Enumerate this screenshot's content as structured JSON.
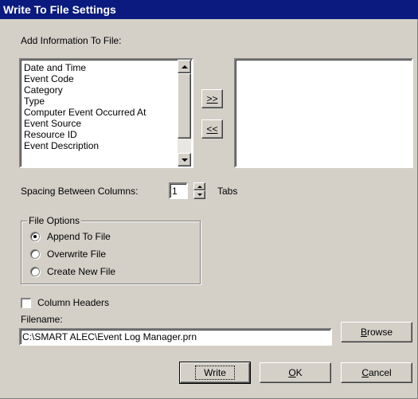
{
  "dialog": {
    "title": "Write To File Settings"
  },
  "add_info": {
    "label": "Add Information To File:",
    "available_items": [
      "Date and Time",
      "Event Code",
      "Category",
      "Type",
      "Computer Event Occurred At",
      "Event Source",
      "Resource ID",
      "Event Description"
    ],
    "add_button": ">>",
    "remove_button": "<<"
  },
  "spacing": {
    "label": "Spacing Between Columns:",
    "value": "1",
    "unit": "Tabs"
  },
  "file_options": {
    "legend": "File Options",
    "options": [
      {
        "label": "Append To File",
        "selected": true
      },
      {
        "label": "Overwrite File",
        "selected": false
      },
      {
        "label": "Create New File",
        "selected": false
      }
    ]
  },
  "column_headers": {
    "label": "Column Headers",
    "checked": false
  },
  "filename": {
    "label": "Filename:",
    "value": "C:\\SMART ALEC\\Event Log Manager.prn",
    "browse_label": "Browse"
  },
  "buttons": {
    "write": "Write",
    "ok": "OK",
    "cancel": "Cancel"
  },
  "colors": {
    "title_bar": "#0a1a7e",
    "face": "#d4d0c8"
  }
}
